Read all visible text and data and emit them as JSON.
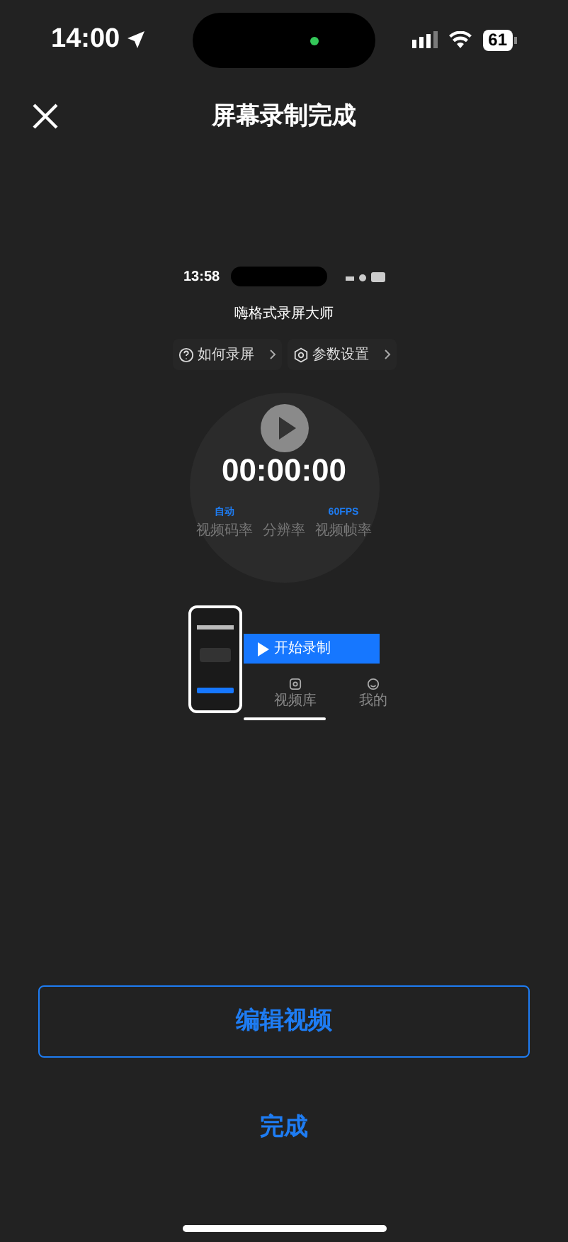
{
  "status_bar": {
    "time": "14:00",
    "battery": "61"
  },
  "header": {
    "title": "屏幕录制完成"
  },
  "preview": {
    "time": "13:58",
    "app_title": "嗨格式录屏大师",
    "menu": [
      {
        "kind": "help",
        "label": "如何录屏"
      },
      {
        "kind": "settings",
        "label": "参数设置"
      }
    ],
    "timer": "00:00:00",
    "stats": [
      {
        "value": "自动",
        "label": "视频码率"
      },
      {
        "label": "分辨率"
      },
      {
        "value": "60FPS",
        "label": "视频帧率"
      }
    ],
    "start_button": "开始录制",
    "tabs": [
      {
        "kind": "library",
        "label": "视频库"
      },
      {
        "kind": "profile",
        "label": "我的"
      }
    ]
  },
  "actions": {
    "edit_button": "编辑视频",
    "done_button": "完成"
  }
}
